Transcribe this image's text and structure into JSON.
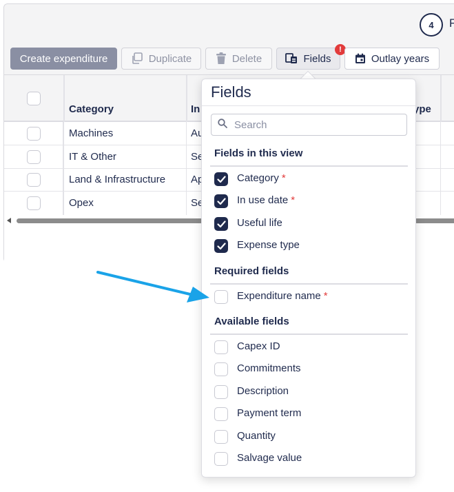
{
  "header": {
    "step_number": "4",
    "step_letter": "F"
  },
  "toolbar": {
    "create_label": "Create expenditure",
    "duplicate_label": "Duplicate",
    "delete_label": "Delete",
    "fields_label": "Fields",
    "fields_badge": "!",
    "outlay_label": "Outlay years"
  },
  "table": {
    "columns": [
      "Category",
      "In",
      "ype"
    ],
    "rows": [
      {
        "category": "Machines",
        "in": "Au"
      },
      {
        "category": "IT & Other",
        "in": "Se"
      },
      {
        "category": "Land & Infrastructure",
        "in": "Ap"
      },
      {
        "category": "Opex",
        "in": "Se"
      }
    ]
  },
  "fields_panel": {
    "title": "Fields",
    "search_placeholder": "Search",
    "sections": {
      "in_view": "Fields in this view",
      "required": "Required fields",
      "available": "Available fields"
    },
    "in_view_fields": [
      {
        "label": "Category",
        "required_mark": "*",
        "checked": true
      },
      {
        "label": "In use date",
        "required_mark": "*",
        "checked": true
      },
      {
        "label": "Useful life",
        "required_mark": "",
        "checked": true
      },
      {
        "label": "Expense type",
        "required_mark": "",
        "checked": true
      }
    ],
    "required_fields": [
      {
        "label": "Expenditure name",
        "required_mark": "*",
        "checked": false
      }
    ],
    "available_fields": [
      {
        "label": "Capex ID",
        "checked": false
      },
      {
        "label": "Commitments",
        "checked": false
      },
      {
        "label": "Description",
        "checked": false
      },
      {
        "label": "Payment term",
        "checked": false
      },
      {
        "label": "Quantity",
        "checked": false
      },
      {
        "label": "Salvage value",
        "checked": false
      }
    ]
  },
  "colors": {
    "accent": "#1f2a4d",
    "required": "#e23b3b",
    "arrow": "#1aa3e8"
  }
}
